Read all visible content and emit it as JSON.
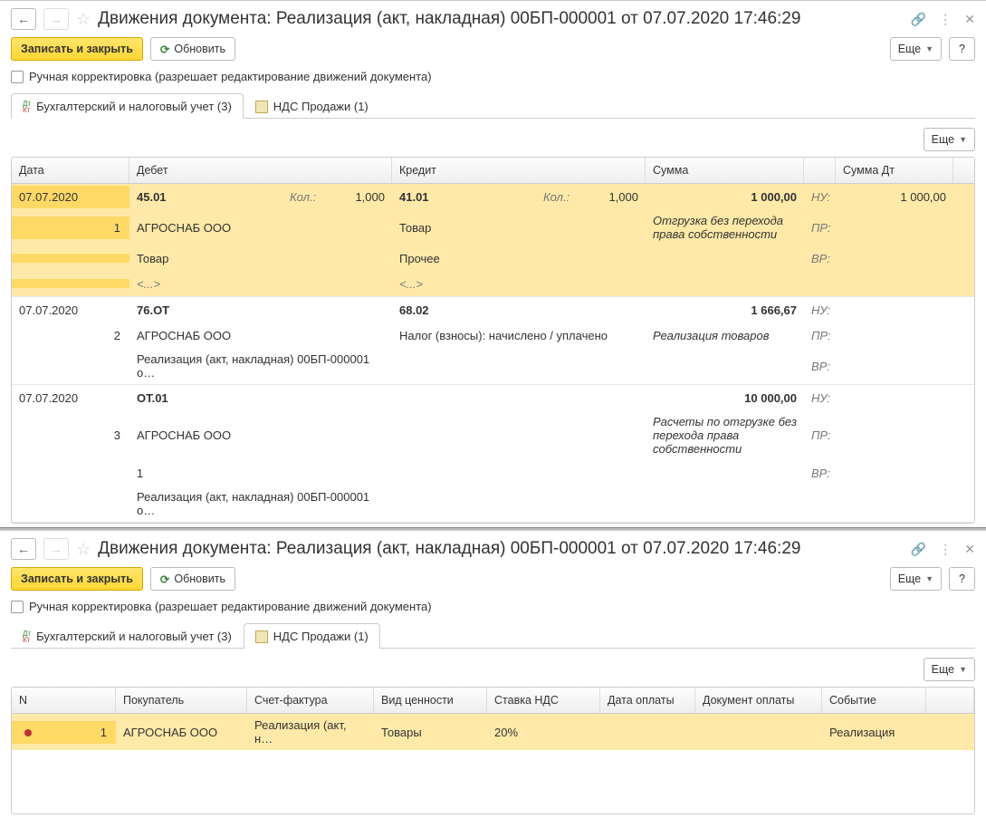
{
  "pane1": {
    "title": "Движения документа: Реализация (акт, накладная) 00БП-000001 от 07.07.2020 17:46:29",
    "btn_save": "Записать и закрыть",
    "btn_refresh": "Обновить",
    "btn_more": "Еще",
    "btn_help": "?",
    "manual_correction": "Ручная корректировка (разрешает редактирование движений документа)",
    "tabs": {
      "accounting": "Бухгалтерский и налоговый учет (3)",
      "vat": "НДС Продажи (1)"
    },
    "grid": {
      "headers": {
        "date": "Дата",
        "debit": "Дебет",
        "credit": "Кредит",
        "sum": "Сумма",
        "sumdt": "Сумма Дт"
      },
      "labels": {
        "qty": "Кол.:",
        "nu": "НУ:",
        "pr": "ПР:",
        "vr": "ВР:",
        "ph": "<...>"
      },
      "rows": [
        {
          "date": "07.07.2020",
          "idx": "1",
          "deb_acct": "45.01",
          "deb_qty": "1,000",
          "deb_l2": "АГРОСНАБ ООО",
          "deb_l3": "Товар",
          "deb_l4": "<...>",
          "cred_acct": "41.01",
          "cred_qty": "1,000",
          "cred_l2": "Товар",
          "cred_l3": "Прочее",
          "cred_l4": "<...>",
          "sum": "1 000,00",
          "desc": "Отгрузка без перехода права собственности",
          "sumdt": "1 000,00",
          "sel": true
        },
        {
          "date": "07.07.2020",
          "idx": "2",
          "deb_acct": "76.ОТ",
          "deb_qty": "",
          "deb_l2": "АГРОСНАБ ООО",
          "deb_l3": "Реализация (акт, накладная) 00БП-000001 о…",
          "deb_l4": "",
          "cred_acct": "68.02",
          "cred_qty": "",
          "cred_l2": "Налог (взносы): начислено / уплачено",
          "cred_l3": "",
          "cred_l4": "",
          "sum": "1 666,67",
          "desc": "Реализация товаров",
          "sumdt": "",
          "sel": false
        },
        {
          "date": "07.07.2020",
          "idx": "3",
          "deb_acct": "ОТ.01",
          "deb_qty": "",
          "deb_l2": "АГРОСНАБ ООО",
          "deb_l3": "1",
          "deb_l4": "Реализация (акт, накладная) 00БП-000001 о…",
          "cred_acct": "",
          "cred_qty": "",
          "cred_l2": "",
          "cred_l3": "",
          "cred_l4": "",
          "sum": "10 000,00",
          "desc": "Расчеты по отгрузке без перехода права собственности",
          "sumdt": "",
          "sel": false
        }
      ]
    }
  },
  "pane2": {
    "title": "Движения документа: Реализация (акт, накладная) 00БП-000001 от 07.07.2020 17:46:29",
    "btn_save": "Записать и закрыть",
    "btn_refresh": "Обновить",
    "btn_more": "Еще",
    "btn_help": "?",
    "manual_correction": "Ручная корректировка (разрешает редактирование движений документа)",
    "tabs": {
      "accounting": "Бухгалтерский и налоговый учет (3)",
      "vat": "НДС Продажи (1)"
    },
    "grid": {
      "headers": {
        "n": "N",
        "buyer": "Покупатель",
        "sf": "Счет-фактура",
        "vid": "Вид ценности",
        "rate": "Ставка НДС",
        "paydate": "Дата оплаты",
        "paydoc": "Документ оплаты",
        "event": "Событие"
      },
      "row": {
        "n": "1",
        "buyer": "АГРОСНАБ ООО",
        "sf": "Реализация (акт, н…",
        "vid": "Товары",
        "rate": "20%",
        "paydate": "",
        "paydoc": "",
        "event": "Реализация"
      }
    }
  }
}
